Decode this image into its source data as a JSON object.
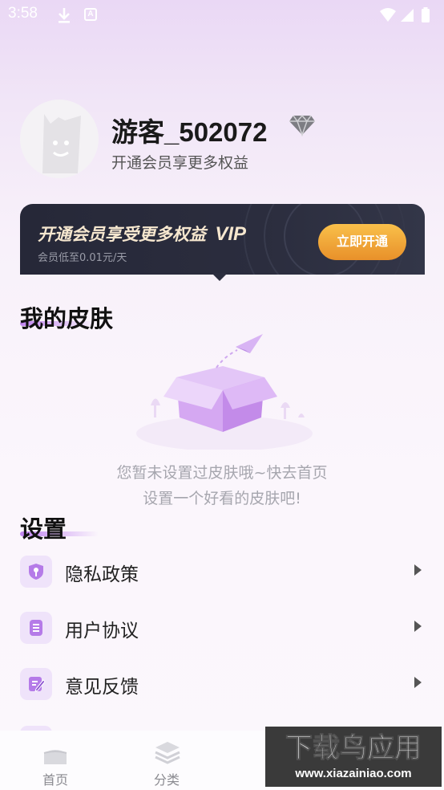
{
  "status_bar": {
    "time": "3:58",
    "a_icon": "A"
  },
  "profile": {
    "username": "游客_502072",
    "subtitle": "开通会员享更多权益",
    "badge_icon": "diamond-icon"
  },
  "vip_banner": {
    "title": "开通会员享受更多权益",
    "vip_tag": "VIP",
    "subtitle": "会员低至0.01元/天",
    "button_label": "立即开通",
    "accent": "#f2a93b"
  },
  "skins": {
    "title": "我的皮肤",
    "empty_line1": "您暂未设置过皮肤哦~快去首页",
    "empty_line2": "设置一个好看的皮肤吧!"
  },
  "settings": {
    "title": "设置",
    "items": [
      {
        "label": "隐私政策",
        "icon": "privacy-icon"
      },
      {
        "label": "用户协议",
        "icon": "agreement-icon"
      },
      {
        "label": "意见反馈",
        "icon": "feedback-icon"
      }
    ]
  },
  "bottom_nav": {
    "items": [
      {
        "label": "首页",
        "icon": "home-icon"
      },
      {
        "label": "分类",
        "icon": "category-icon"
      }
    ]
  },
  "watermark": {
    "logo_text": "下载鸟应用",
    "url": "www.xiazainiao.com"
  },
  "colors": {
    "accent_purple": "#b57be8",
    "banner_dark": "#2a2c3d"
  }
}
